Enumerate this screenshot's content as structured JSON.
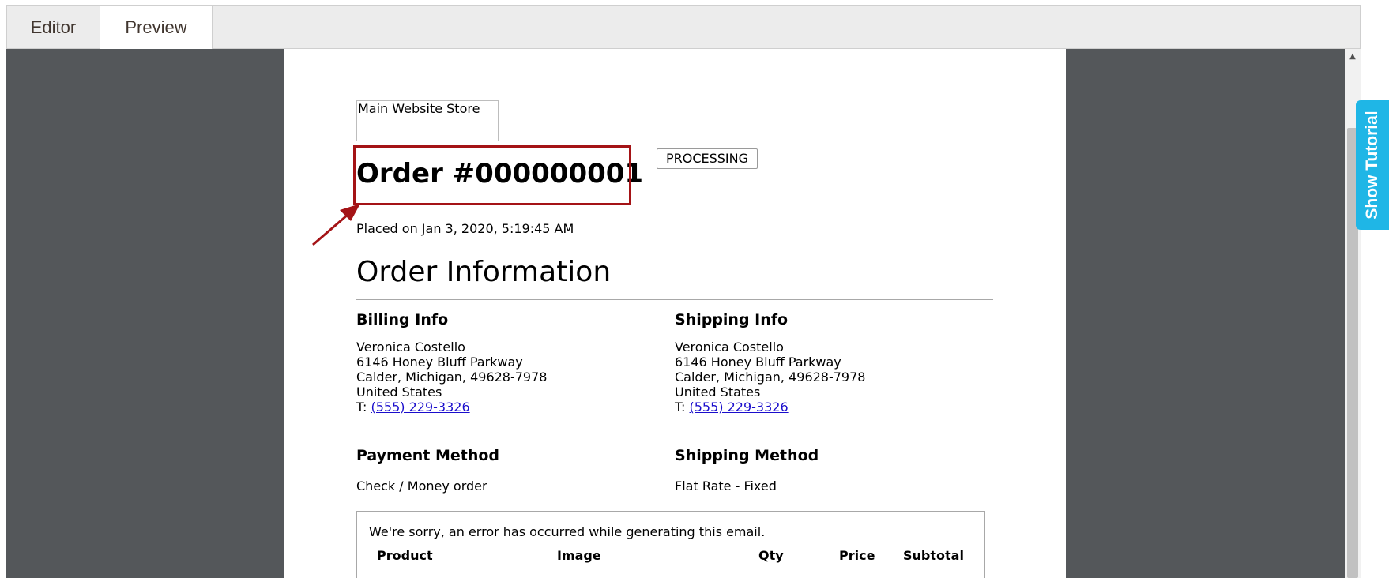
{
  "tabs": [
    {
      "label": "Editor",
      "active": false
    },
    {
      "label": "Preview",
      "active": true
    }
  ],
  "email": {
    "store_name": "Main Website Store",
    "order_title": "Order #000000001",
    "status": "PROCESSING",
    "placed_on": "Placed on Jan 3, 2020, 5:19:45 AM",
    "section_title": "Order Information",
    "billing": {
      "heading": "Billing Info",
      "name": "Veronica Costello",
      "street": "6146 Honey Bluff Parkway",
      "city": "Calder, Michigan, 49628-7978",
      "country": "United States",
      "phone_prefix": "T: ",
      "phone": "(555) 229-3326"
    },
    "shipping": {
      "heading": "Shipping Info",
      "name": "Veronica Costello",
      "street": "6146 Honey Bluff Parkway",
      "city": "Calder, Michigan, 49628-7978",
      "country": "United States",
      "phone_prefix": "T: ",
      "phone": "(555) 229-3326"
    },
    "payment": {
      "heading": "Payment Method",
      "value": "Check / Money order"
    },
    "shipping_method": {
      "heading": "Shipping Method",
      "value": "Flat Rate - Fixed"
    },
    "items": {
      "error": "We're sorry, an error has occurred while generating this email.",
      "columns": [
        "Product",
        "Image",
        "Qty",
        "Price",
        "Subtotal"
      ]
    }
  },
  "tutorial_button": "Show Tutorial",
  "colors": {
    "highlight": "#a41316",
    "tutorial": "#1fb6e6",
    "link": "#1a0dcc",
    "stage": "#54575a"
  },
  "icons": {
    "annotation": "arrow-icon",
    "scroll": "scroll-up-icon"
  }
}
